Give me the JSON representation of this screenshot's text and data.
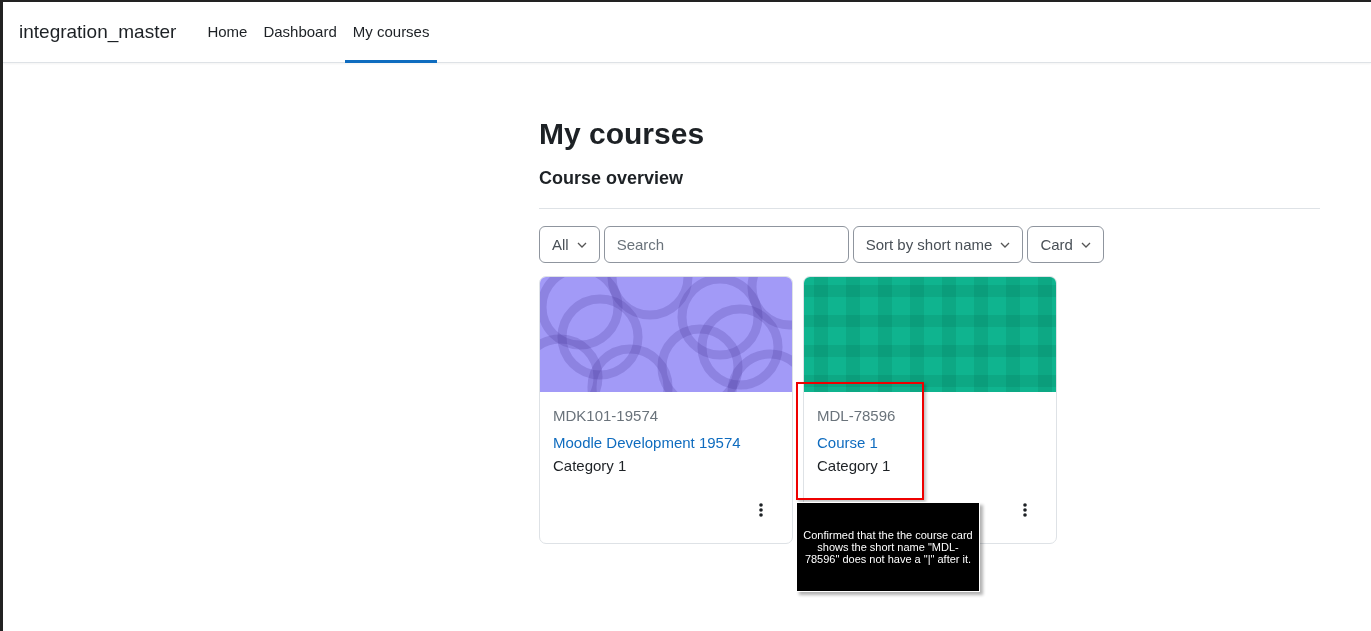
{
  "site_name": "integration_master",
  "nav": [
    {
      "label": "Home",
      "selected": false
    },
    {
      "label": "Dashboard",
      "selected": false
    },
    {
      "label": "My courses",
      "selected": true
    }
  ],
  "page_title": "My courses",
  "section_title": "Course overview",
  "filters": {
    "grouping": "All",
    "search": {
      "placeholder": "Search"
    },
    "sort": "Sort by short name",
    "view": "Card"
  },
  "courses": [
    {
      "short_name": "MDK101-19574",
      "name": "Moodle Development 19574",
      "category": "Category 1",
      "kind": "circles",
      "color": "#a29af7"
    },
    {
      "short_name": "MDL-78596",
      "name": "Course 1",
      "category": "Category 1",
      "kind": "plaid",
      "color": "#0fb48f"
    }
  ],
  "annotation": {
    "note": "Confirmed that the the course card shows the short name \"MDL-78596\" does not have a \"|\" after it."
  }
}
